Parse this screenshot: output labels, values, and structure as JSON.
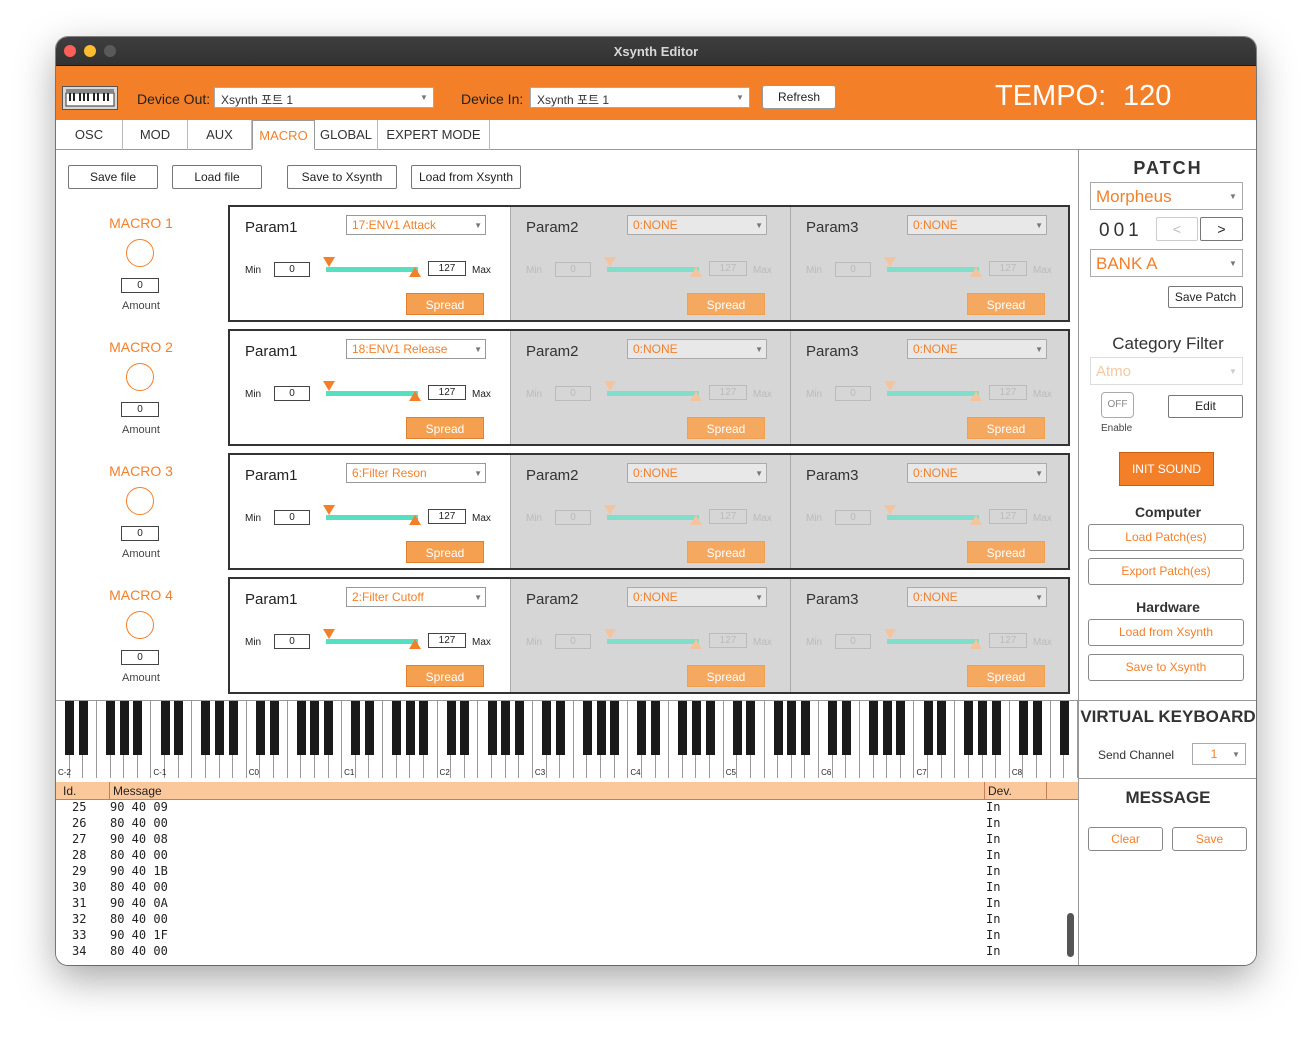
{
  "window": {
    "title": "Xsynth Editor"
  },
  "topbar": {
    "device_out_label": "Device Out:",
    "device_out_value": "Xsynth 포트 1",
    "device_in_label": "Device In:",
    "device_in_value": "Xsynth 포트 1",
    "refresh_label": "Refresh",
    "tempo_label": "TEMPO:",
    "tempo_value": "120"
  },
  "tabs": [
    {
      "label": "OSC"
    },
    {
      "label": "MOD"
    },
    {
      "label": "AUX"
    },
    {
      "label": "MACRO"
    },
    {
      "label": "GLOBAL"
    },
    {
      "label": "EXPERT MODE"
    }
  ],
  "toolbar": {
    "save_file": "Save file",
    "load_file": "Load file",
    "save_to_xsynth": "Save to Xsynth",
    "load_from_xsynth": "Load from Xsynth"
  },
  "macros": [
    {
      "label": "MACRO  1",
      "amount": "0",
      "amount_label": "Amount",
      "params": [
        {
          "name": "Param1",
          "select": "17:ENV1 Attack",
          "min": "0",
          "max": "127",
          "min_label": "Min",
          "max_label": "Max",
          "spread": "Spread"
        },
        {
          "name": "Param2",
          "select": "0:NONE",
          "min": "0",
          "max": "127",
          "min_label": "Min",
          "max_label": "Max",
          "spread": "Spread"
        },
        {
          "name": "Param3",
          "select": "0:NONE",
          "min": "0",
          "max": "127",
          "min_label": "Min",
          "max_label": "Max",
          "spread": "Spread"
        }
      ]
    },
    {
      "label": "MACRO  2",
      "amount": "0",
      "amount_label": "Amount",
      "params": [
        {
          "name": "Param1",
          "select": "18:ENV1 Release",
          "min": "0",
          "max": "127",
          "min_label": "Min",
          "max_label": "Max",
          "spread": "Spread"
        },
        {
          "name": "Param2",
          "select": "0:NONE",
          "min": "0",
          "max": "127",
          "min_label": "Min",
          "max_label": "Max",
          "spread": "Spread"
        },
        {
          "name": "Param3",
          "select": "0:NONE",
          "min": "0",
          "max": "127",
          "min_label": "Min",
          "max_label": "Max",
          "spread": "Spread"
        }
      ]
    },
    {
      "label": "MACRO  3",
      "amount": "0",
      "amount_label": "Amount",
      "params": [
        {
          "name": "Param1",
          "select": "6:Filter Reson",
          "min": "0",
          "max": "127",
          "min_label": "Min",
          "max_label": "Max",
          "spread": "Spread"
        },
        {
          "name": "Param2",
          "select": "0:NONE",
          "min": "0",
          "max": "127",
          "min_label": "Min",
          "max_label": "Max",
          "spread": "Spread"
        },
        {
          "name": "Param3",
          "select": "0:NONE",
          "min": "0",
          "max": "127",
          "min_label": "Min",
          "max_label": "Max",
          "spread": "Spread"
        }
      ]
    },
    {
      "label": "MACRO  4",
      "amount": "0",
      "amount_label": "Amount",
      "params": [
        {
          "name": "Param1",
          "select": "2:Filter Cutoff",
          "min": "0",
          "max": "127",
          "min_label": "Min",
          "max_label": "Max",
          "spread": "Spread"
        },
        {
          "name": "Param2",
          "select": "0:NONE",
          "min": "0",
          "max": "127",
          "min_label": "Min",
          "max_label": "Max",
          "spread": "Spread"
        },
        {
          "name": "Param3",
          "select": "0:NONE",
          "min": "0",
          "max": "127",
          "min_label": "Min",
          "max_label": "Max",
          "spread": "Spread"
        }
      ]
    }
  ],
  "patch": {
    "heading": "PATCH",
    "name": "Morpheus",
    "number": "001",
    "prev": "<",
    "next": ">",
    "bank": "BANK A",
    "save_patch": "Save Patch",
    "category_heading": "Category Filter",
    "category_value": "Atmo",
    "toggle": "OFF",
    "enable_label": "Enable",
    "edit": "Edit",
    "init_sound": "INIT  SOUND",
    "computer_heading": "Computer",
    "load_patches": "Load Patch(es)",
    "export_patches": "Export Patch(es)",
    "hardware_heading": "Hardware",
    "load_from_xsynth": "Load from Xsynth",
    "save_to_xsynth": "Save to Xsynth"
  },
  "virtual_keyboard": {
    "heading": "VIRTUAL KEYBOARD",
    "send_channel_label": "Send Channel",
    "send_channel_value": "1",
    "octave_labels": [
      "C-2",
      "C-1",
      "C0",
      "C1",
      "C2",
      "C3",
      "C4",
      "C5",
      "C6",
      "C7",
      "C8"
    ]
  },
  "message_panel": {
    "heading": "MESSAGE",
    "clear": "Clear",
    "save": "Save"
  },
  "log": {
    "headers": {
      "id": "Id.",
      "message": "Message",
      "dev": "Dev."
    },
    "rows": [
      {
        "id": "25",
        "message": "90 40 09",
        "dev": "In"
      },
      {
        "id": "26",
        "message": "80 40 00",
        "dev": "In"
      },
      {
        "id": "27",
        "message": "90 40 08",
        "dev": "In"
      },
      {
        "id": "28",
        "message": "80 40 00",
        "dev": "In"
      },
      {
        "id": "29",
        "message": "90 40 1B",
        "dev": "In"
      },
      {
        "id": "30",
        "message": "80 40 00",
        "dev": "In"
      },
      {
        "id": "31",
        "message": "90 40 0A",
        "dev": "In"
      },
      {
        "id": "32",
        "message": "80 40 00",
        "dev": "In"
      },
      {
        "id": "33",
        "message": "90 40 1F",
        "dev": "In"
      },
      {
        "id": "34",
        "message": "80 40 00",
        "dev": "In"
      }
    ]
  },
  "colors": {
    "accent": "#f47f29",
    "teal": "#55e0c0",
    "header_bg": "#fbc89c"
  }
}
